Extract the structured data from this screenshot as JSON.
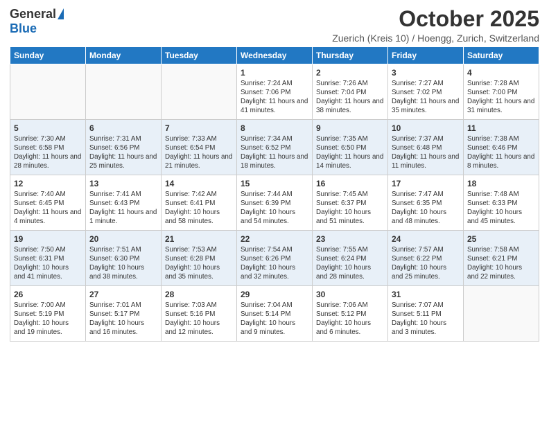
{
  "logo": {
    "general": "General",
    "blue": "Blue"
  },
  "header": {
    "month": "October 2025",
    "location": "Zuerich (Kreis 10) / Hoengg, Zurich, Switzerland"
  },
  "weekdays": [
    "Sunday",
    "Monday",
    "Tuesday",
    "Wednesday",
    "Thursday",
    "Friday",
    "Saturday"
  ],
  "weeks": [
    [
      {
        "day": "",
        "sunrise": "",
        "sunset": "",
        "daylight": ""
      },
      {
        "day": "",
        "sunrise": "",
        "sunset": "",
        "daylight": ""
      },
      {
        "day": "",
        "sunrise": "",
        "sunset": "",
        "daylight": ""
      },
      {
        "day": "1",
        "sunrise": "Sunrise: 7:24 AM",
        "sunset": "Sunset: 7:06 PM",
        "daylight": "Daylight: 11 hours and 41 minutes."
      },
      {
        "day": "2",
        "sunrise": "Sunrise: 7:26 AM",
        "sunset": "Sunset: 7:04 PM",
        "daylight": "Daylight: 11 hours and 38 minutes."
      },
      {
        "day": "3",
        "sunrise": "Sunrise: 7:27 AM",
        "sunset": "Sunset: 7:02 PM",
        "daylight": "Daylight: 11 hours and 35 minutes."
      },
      {
        "day": "4",
        "sunrise": "Sunrise: 7:28 AM",
        "sunset": "Sunset: 7:00 PM",
        "daylight": "Daylight: 11 hours and 31 minutes."
      }
    ],
    [
      {
        "day": "5",
        "sunrise": "Sunrise: 7:30 AM",
        "sunset": "Sunset: 6:58 PM",
        "daylight": "Daylight: 11 hours and 28 minutes."
      },
      {
        "day": "6",
        "sunrise": "Sunrise: 7:31 AM",
        "sunset": "Sunset: 6:56 PM",
        "daylight": "Daylight: 11 hours and 25 minutes."
      },
      {
        "day": "7",
        "sunrise": "Sunrise: 7:33 AM",
        "sunset": "Sunset: 6:54 PM",
        "daylight": "Daylight: 11 hours and 21 minutes."
      },
      {
        "day": "8",
        "sunrise": "Sunrise: 7:34 AM",
        "sunset": "Sunset: 6:52 PM",
        "daylight": "Daylight: 11 hours and 18 minutes."
      },
      {
        "day": "9",
        "sunrise": "Sunrise: 7:35 AM",
        "sunset": "Sunset: 6:50 PM",
        "daylight": "Daylight: 11 hours and 14 minutes."
      },
      {
        "day": "10",
        "sunrise": "Sunrise: 7:37 AM",
        "sunset": "Sunset: 6:48 PM",
        "daylight": "Daylight: 11 hours and 11 minutes."
      },
      {
        "day": "11",
        "sunrise": "Sunrise: 7:38 AM",
        "sunset": "Sunset: 6:46 PM",
        "daylight": "Daylight: 11 hours and 8 minutes."
      }
    ],
    [
      {
        "day": "12",
        "sunrise": "Sunrise: 7:40 AM",
        "sunset": "Sunset: 6:45 PM",
        "daylight": "Daylight: 11 hours and 4 minutes."
      },
      {
        "day": "13",
        "sunrise": "Sunrise: 7:41 AM",
        "sunset": "Sunset: 6:43 PM",
        "daylight": "Daylight: 11 hours and 1 minute."
      },
      {
        "day": "14",
        "sunrise": "Sunrise: 7:42 AM",
        "sunset": "Sunset: 6:41 PM",
        "daylight": "Daylight: 10 hours and 58 minutes."
      },
      {
        "day": "15",
        "sunrise": "Sunrise: 7:44 AM",
        "sunset": "Sunset: 6:39 PM",
        "daylight": "Daylight: 10 hours and 54 minutes."
      },
      {
        "day": "16",
        "sunrise": "Sunrise: 7:45 AM",
        "sunset": "Sunset: 6:37 PM",
        "daylight": "Daylight: 10 hours and 51 minutes."
      },
      {
        "day": "17",
        "sunrise": "Sunrise: 7:47 AM",
        "sunset": "Sunset: 6:35 PM",
        "daylight": "Daylight: 10 hours and 48 minutes."
      },
      {
        "day": "18",
        "sunrise": "Sunrise: 7:48 AM",
        "sunset": "Sunset: 6:33 PM",
        "daylight": "Daylight: 10 hours and 45 minutes."
      }
    ],
    [
      {
        "day": "19",
        "sunrise": "Sunrise: 7:50 AM",
        "sunset": "Sunset: 6:31 PM",
        "daylight": "Daylight: 10 hours and 41 minutes."
      },
      {
        "day": "20",
        "sunrise": "Sunrise: 7:51 AM",
        "sunset": "Sunset: 6:30 PM",
        "daylight": "Daylight: 10 hours and 38 minutes."
      },
      {
        "day": "21",
        "sunrise": "Sunrise: 7:53 AM",
        "sunset": "Sunset: 6:28 PM",
        "daylight": "Daylight: 10 hours and 35 minutes."
      },
      {
        "day": "22",
        "sunrise": "Sunrise: 7:54 AM",
        "sunset": "Sunset: 6:26 PM",
        "daylight": "Daylight: 10 hours and 32 minutes."
      },
      {
        "day": "23",
        "sunrise": "Sunrise: 7:55 AM",
        "sunset": "Sunset: 6:24 PM",
        "daylight": "Daylight: 10 hours and 28 minutes."
      },
      {
        "day": "24",
        "sunrise": "Sunrise: 7:57 AM",
        "sunset": "Sunset: 6:22 PM",
        "daylight": "Daylight: 10 hours and 25 minutes."
      },
      {
        "day": "25",
        "sunrise": "Sunrise: 7:58 AM",
        "sunset": "Sunset: 6:21 PM",
        "daylight": "Daylight: 10 hours and 22 minutes."
      }
    ],
    [
      {
        "day": "26",
        "sunrise": "Sunrise: 7:00 AM",
        "sunset": "Sunset: 5:19 PM",
        "daylight": "Daylight: 10 hours and 19 minutes."
      },
      {
        "day": "27",
        "sunrise": "Sunrise: 7:01 AM",
        "sunset": "Sunset: 5:17 PM",
        "daylight": "Daylight: 10 hours and 16 minutes."
      },
      {
        "day": "28",
        "sunrise": "Sunrise: 7:03 AM",
        "sunset": "Sunset: 5:16 PM",
        "daylight": "Daylight: 10 hours and 12 minutes."
      },
      {
        "day": "29",
        "sunrise": "Sunrise: 7:04 AM",
        "sunset": "Sunset: 5:14 PM",
        "daylight": "Daylight: 10 hours and 9 minutes."
      },
      {
        "day": "30",
        "sunrise": "Sunrise: 7:06 AM",
        "sunset": "Sunset: 5:12 PM",
        "daylight": "Daylight: 10 hours and 6 minutes."
      },
      {
        "day": "31",
        "sunrise": "Sunrise: 7:07 AM",
        "sunset": "Sunset: 5:11 PM",
        "daylight": "Daylight: 10 hours and 3 minutes."
      },
      {
        "day": "",
        "sunrise": "",
        "sunset": "",
        "daylight": ""
      }
    ]
  ]
}
